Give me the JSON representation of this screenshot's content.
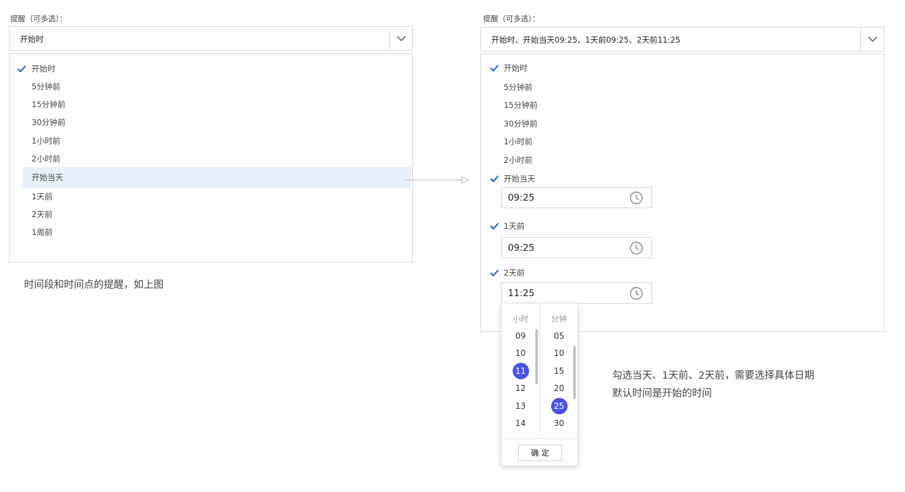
{
  "left": {
    "label": "提醒（可多选）：",
    "selected_value": "开始时",
    "options": [
      "开始时",
      "5分钟前",
      "15分钟前",
      "30分钟前",
      "1小时前",
      "2小时前",
      "开始当天",
      "1天前",
      "2天前",
      "1周前"
    ]
  },
  "right": {
    "label": "提醒（可多选）：",
    "selected_value": "开始时、开始当天09:25、1天前09:25、2天前11:25",
    "options": [
      "开始时",
      "5分钟前",
      "15分钟前",
      "30分钟前",
      "1小时前",
      "2小时前",
      "开始当天",
      "1天前",
      "2天前"
    ],
    "times": [
      "09:25",
      "09:25",
      "11:25"
    ]
  },
  "picker": {
    "hour_label": "小时",
    "minute_label": "分钟",
    "hours": [
      "09",
      "10",
      "11",
      "12",
      "13",
      "14"
    ],
    "minutes": [
      "05",
      "10",
      "15",
      "20",
      "25",
      "30"
    ],
    "selected_hour": "11",
    "selected_minute": "25",
    "confirm": "确 定"
  },
  "notes": {
    "left_caption": "时间段和时间点的提醒，如上图",
    "right_line1": "勾选当天、1天前、2天前，需要选择具体日期",
    "right_line2": "默认时间是开始的时间"
  },
  "colors": {
    "check": "#1a5fc8",
    "highlight": "#e8f1fb",
    "picker_selected": "#4b53e5"
  }
}
